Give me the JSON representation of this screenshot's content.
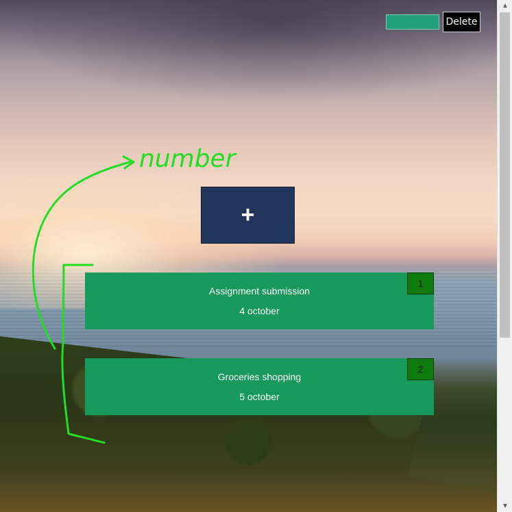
{
  "toolbar": {
    "input_value": "",
    "delete_label": "Delete",
    "input_color": "#1fa07a"
  },
  "add_button": {
    "label": "+",
    "color": "#22365c"
  },
  "tasks": [
    {
      "number": "1",
      "title": "Assignment submission",
      "date": "4 october"
    },
    {
      "number": "2",
      "title": "Groceries shopping",
      "date": "5 october"
    }
  ],
  "annotation": {
    "text": "number",
    "color": "#22dd22"
  },
  "colors": {
    "card": "#16995a",
    "badge": "#0c7a0c"
  },
  "scrollbar": {
    "up_icon": "chevron-up-icon",
    "down_icon": "chevron-down-icon"
  }
}
